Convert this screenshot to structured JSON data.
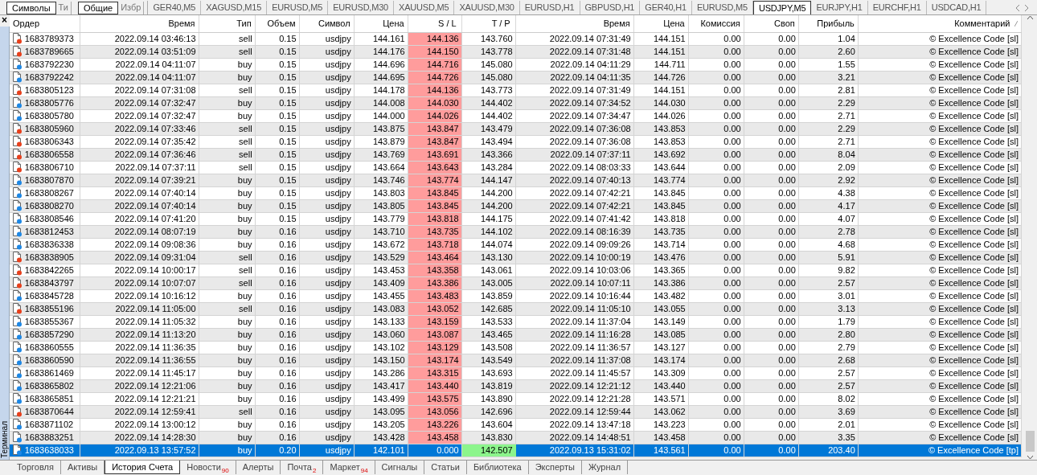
{
  "panel_buttons": [
    {
      "label": "Символы",
      "kind": "button"
    },
    {
      "label": "Ти",
      "kind": "cut"
    },
    {
      "label": "Общие",
      "kind": "button"
    },
    {
      "label": "Избр",
      "kind": "cut"
    }
  ],
  "chart_tabs": [
    {
      "label": "GER40,M5",
      "selected": false
    },
    {
      "label": "XAGUSD,M15",
      "selected": false
    },
    {
      "label": "EURUSD,M5",
      "selected": false
    },
    {
      "label": "EURUSD,M30",
      "selected": false
    },
    {
      "label": "XAUUSD,M5",
      "selected": false
    },
    {
      "label": "XAUUSD,M30",
      "selected": false
    },
    {
      "label": "EURUSD,H1",
      "selected": false
    },
    {
      "label": "GBPUSD,H1",
      "selected": false
    },
    {
      "label": "GER40,H1",
      "selected": false
    },
    {
      "label": "EURUSD,M5",
      "selected": false
    },
    {
      "label": "USDJPY,M5",
      "selected": true
    },
    {
      "label": "EURJPY,H1",
      "selected": false
    },
    {
      "label": "EURCHF,H1",
      "selected": false
    },
    {
      "label": "USDCAD,H1",
      "selected": false
    }
  ],
  "side_panel": {
    "close": "×",
    "title": "Терминал"
  },
  "table": {
    "columns": [
      "Ордер",
      "Время",
      "Тип",
      "Объем",
      "Символ",
      "Цена",
      "S / L",
      "T / P",
      "Время",
      "Цена",
      "Комиссия",
      "Своп",
      "Прибыль",
      "Комментарий"
    ],
    "rows": [
      {
        "kind": "sell",
        "sl_hit": true,
        "tp_hit": false,
        "selected": false,
        "cells": [
          "1683789373",
          "2022.09.14 03:46:13",
          "sell",
          "0.15",
          "usdjpy",
          "144.161",
          "144.136",
          "143.760",
          "2022.09.14 07:31:49",
          "144.151",
          "0.00",
          "0.00",
          "1.04",
          "© Excellence Code [sl]"
        ]
      },
      {
        "kind": "sell",
        "sl_hit": true,
        "tp_hit": false,
        "selected": false,
        "cells": [
          "1683789665",
          "2022.09.14 03:51:09",
          "sell",
          "0.15",
          "usdjpy",
          "144.176",
          "144.150",
          "143.778",
          "2022.09.14 07:31:48",
          "144.151",
          "0.00",
          "0.00",
          "2.60",
          "© Excellence Code [sl]"
        ]
      },
      {
        "kind": "buy",
        "sl_hit": true,
        "tp_hit": false,
        "selected": false,
        "cells": [
          "1683792230",
          "2022.09.14 04:11:07",
          "buy",
          "0.15",
          "usdjpy",
          "144.696",
          "144.716",
          "145.080",
          "2022.09.14 04:11:29",
          "144.711",
          "0.00",
          "0.00",
          "1.55",
          "© Excellence Code [sl]"
        ]
      },
      {
        "kind": "buy",
        "sl_hit": true,
        "tp_hit": false,
        "selected": false,
        "cells": [
          "1683792242",
          "2022.09.14 04:11:07",
          "buy",
          "0.15",
          "usdjpy",
          "144.695",
          "144.726",
          "145.080",
          "2022.09.14 04:11:35",
          "144.726",
          "0.00",
          "0.00",
          "3.21",
          "© Excellence Code [sl]"
        ]
      },
      {
        "kind": "sell",
        "sl_hit": true,
        "tp_hit": false,
        "selected": false,
        "cells": [
          "1683805123",
          "2022.09.14 07:31:08",
          "sell",
          "0.15",
          "usdjpy",
          "144.178",
          "144.136",
          "143.773",
          "2022.09.14 07:31:49",
          "144.151",
          "0.00",
          "0.00",
          "2.81",
          "© Excellence Code [sl]"
        ]
      },
      {
        "kind": "buy",
        "sl_hit": true,
        "tp_hit": false,
        "selected": false,
        "cells": [
          "1683805776",
          "2022.09.14 07:32:47",
          "buy",
          "0.15",
          "usdjpy",
          "144.008",
          "144.030",
          "144.402",
          "2022.09.14 07:34:52",
          "144.030",
          "0.00",
          "0.00",
          "2.29",
          "© Excellence Code [sl]"
        ]
      },
      {
        "kind": "buy",
        "sl_hit": true,
        "tp_hit": false,
        "selected": false,
        "cells": [
          "1683805780",
          "2022.09.14 07:32:47",
          "buy",
          "0.15",
          "usdjpy",
          "144.000",
          "144.026",
          "144.402",
          "2022.09.14 07:34:47",
          "144.026",
          "0.00",
          "0.00",
          "2.71",
          "© Excellence Code [sl]"
        ]
      },
      {
        "kind": "sell",
        "sl_hit": true,
        "tp_hit": false,
        "selected": false,
        "cells": [
          "1683805960",
          "2022.09.14 07:33:46",
          "sell",
          "0.15",
          "usdjpy",
          "143.875",
          "143.847",
          "143.479",
          "2022.09.14 07:36:08",
          "143.853",
          "0.00",
          "0.00",
          "2.29",
          "© Excellence Code [sl]"
        ]
      },
      {
        "kind": "sell",
        "sl_hit": true,
        "tp_hit": false,
        "selected": false,
        "cells": [
          "1683806343",
          "2022.09.14 07:35:42",
          "sell",
          "0.15",
          "usdjpy",
          "143.879",
          "143.847",
          "143.494",
          "2022.09.14 07:36:08",
          "143.853",
          "0.00",
          "0.00",
          "2.71",
          "© Excellence Code [sl]"
        ]
      },
      {
        "kind": "sell",
        "sl_hit": true,
        "tp_hit": false,
        "selected": false,
        "cells": [
          "1683806558",
          "2022.09.14 07:36:46",
          "sell",
          "0.15",
          "usdjpy",
          "143.769",
          "143.691",
          "143.366",
          "2022.09.14 07:37:11",
          "143.692",
          "0.00",
          "0.00",
          "8.04",
          "© Excellence Code [sl]"
        ]
      },
      {
        "kind": "sell",
        "sl_hit": true,
        "tp_hit": false,
        "selected": false,
        "cells": [
          "1683806710",
          "2022.09.14 07:37:11",
          "sell",
          "0.15",
          "usdjpy",
          "143.664",
          "143.643",
          "143.284",
          "2022.09.14 08:03:33",
          "143.644",
          "0.00",
          "0.00",
          "2.09",
          "© Excellence Code [sl]"
        ]
      },
      {
        "kind": "buy",
        "sl_hit": true,
        "tp_hit": false,
        "selected": false,
        "cells": [
          "1683807870",
          "2022.09.14 07:39:21",
          "buy",
          "0.15",
          "usdjpy",
          "143.746",
          "143.774",
          "144.147",
          "2022.09.14 07:40:13",
          "143.774",
          "0.00",
          "0.00",
          "2.92",
          "© Excellence Code [sl]"
        ]
      },
      {
        "kind": "buy",
        "sl_hit": true,
        "tp_hit": false,
        "selected": false,
        "cells": [
          "1683808267",
          "2022.09.14 07:40:14",
          "buy",
          "0.15",
          "usdjpy",
          "143.803",
          "143.845",
          "144.200",
          "2022.09.14 07:42:21",
          "143.845",
          "0.00",
          "0.00",
          "4.38",
          "© Excellence Code [sl]"
        ]
      },
      {
        "kind": "buy",
        "sl_hit": true,
        "tp_hit": false,
        "selected": false,
        "cells": [
          "1683808270",
          "2022.09.14 07:40:14",
          "buy",
          "0.15",
          "usdjpy",
          "143.805",
          "143.845",
          "144.200",
          "2022.09.14 07:42:21",
          "143.845",
          "0.00",
          "0.00",
          "4.17",
          "© Excellence Code [sl]"
        ]
      },
      {
        "kind": "buy",
        "sl_hit": true,
        "tp_hit": false,
        "selected": false,
        "cells": [
          "1683808546",
          "2022.09.14 07:41:20",
          "buy",
          "0.15",
          "usdjpy",
          "143.779",
          "143.818",
          "144.175",
          "2022.09.14 07:41:42",
          "143.818",
          "0.00",
          "0.00",
          "4.07",
          "© Excellence Code [sl]"
        ]
      },
      {
        "kind": "buy",
        "sl_hit": true,
        "tp_hit": false,
        "selected": false,
        "cells": [
          "1683812453",
          "2022.09.14 08:07:19",
          "buy",
          "0.16",
          "usdjpy",
          "143.710",
          "143.735",
          "144.102",
          "2022.09.14 08:16:39",
          "143.735",
          "0.00",
          "0.00",
          "2.78",
          "© Excellence Code [sl]"
        ]
      },
      {
        "kind": "buy",
        "sl_hit": true,
        "tp_hit": false,
        "selected": false,
        "cells": [
          "1683836338",
          "2022.09.14 09:08:36",
          "buy",
          "0.16",
          "usdjpy",
          "143.672",
          "143.718",
          "144.074",
          "2022.09.14 09:09:26",
          "143.714",
          "0.00",
          "0.00",
          "4.68",
          "© Excellence Code [sl]"
        ]
      },
      {
        "kind": "sell",
        "sl_hit": true,
        "tp_hit": false,
        "selected": false,
        "cells": [
          "1683838905",
          "2022.09.14 09:31:04",
          "sell",
          "0.16",
          "usdjpy",
          "143.529",
          "143.464",
          "143.130",
          "2022.09.14 10:00:19",
          "143.476",
          "0.00",
          "0.00",
          "5.91",
          "© Excellence Code [sl]"
        ]
      },
      {
        "kind": "sell",
        "sl_hit": true,
        "tp_hit": false,
        "selected": false,
        "cells": [
          "1683842265",
          "2022.09.14 10:00:17",
          "sell",
          "0.16",
          "usdjpy",
          "143.453",
          "143.358",
          "143.061",
          "2022.09.14 10:03:06",
          "143.365",
          "0.00",
          "0.00",
          "9.82",
          "© Excellence Code [sl]"
        ]
      },
      {
        "kind": "sell",
        "sl_hit": true,
        "tp_hit": false,
        "selected": false,
        "cells": [
          "1683843797",
          "2022.09.14 10:07:07",
          "sell",
          "0.16",
          "usdjpy",
          "143.409",
          "143.386",
          "143.005",
          "2022.09.14 10:07:11",
          "143.386",
          "0.00",
          "0.00",
          "2.57",
          "© Excellence Code [sl]"
        ]
      },
      {
        "kind": "buy",
        "sl_hit": true,
        "tp_hit": false,
        "selected": false,
        "cells": [
          "1683845728",
          "2022.09.14 10:16:12",
          "buy",
          "0.16",
          "usdjpy",
          "143.455",
          "143.483",
          "143.859",
          "2022.09.14 10:16:44",
          "143.482",
          "0.00",
          "0.00",
          "3.01",
          "© Excellence Code [sl]"
        ]
      },
      {
        "kind": "sell",
        "sl_hit": true,
        "tp_hit": false,
        "selected": false,
        "cells": [
          "1683855196",
          "2022.09.14 11:05:00",
          "sell",
          "0.16",
          "usdjpy",
          "143.083",
          "143.052",
          "142.685",
          "2022.09.14 11:05:10",
          "143.055",
          "0.00",
          "0.00",
          "3.13",
          "© Excellence Code [sl]"
        ]
      },
      {
        "kind": "buy",
        "sl_hit": true,
        "tp_hit": false,
        "selected": false,
        "cells": [
          "1683855367",
          "2022.09.14 11:05:32",
          "buy",
          "0.16",
          "usdjpy",
          "143.133",
          "143.159",
          "143.533",
          "2022.09.14 11:37:04",
          "143.149",
          "0.00",
          "0.00",
          "1.79",
          "© Excellence Code [sl]"
        ]
      },
      {
        "kind": "buy",
        "sl_hit": true,
        "tp_hit": false,
        "selected": false,
        "cells": [
          "1683857290",
          "2022.09.14 11:13:20",
          "buy",
          "0.16",
          "usdjpy",
          "143.060",
          "143.087",
          "143.465",
          "2022.09.14 11:16:28",
          "143.085",
          "0.00",
          "0.00",
          "2.80",
          "© Excellence Code [sl]"
        ]
      },
      {
        "kind": "buy",
        "sl_hit": true,
        "tp_hit": false,
        "selected": false,
        "cells": [
          "1683860555",
          "2022.09.14 11:36:35",
          "buy",
          "0.16",
          "usdjpy",
          "143.102",
          "143.129",
          "143.508",
          "2022.09.14 11:36:57",
          "143.127",
          "0.00",
          "0.00",
          "2.79",
          "© Excellence Code [sl]"
        ]
      },
      {
        "kind": "buy",
        "sl_hit": true,
        "tp_hit": false,
        "selected": false,
        "cells": [
          "1683860590",
          "2022.09.14 11:36:55",
          "buy",
          "0.16",
          "usdjpy",
          "143.150",
          "143.174",
          "143.549",
          "2022.09.14 11:37:08",
          "143.174",
          "0.00",
          "0.00",
          "2.68",
          "© Excellence Code [sl]"
        ]
      },
      {
        "kind": "buy",
        "sl_hit": true,
        "tp_hit": false,
        "selected": false,
        "cells": [
          "1683861469",
          "2022.09.14 11:45:17",
          "buy",
          "0.16",
          "usdjpy",
          "143.286",
          "143.315",
          "143.693",
          "2022.09.14 11:45:57",
          "143.309",
          "0.00",
          "0.00",
          "2.57",
          "© Excellence Code [sl]"
        ]
      },
      {
        "kind": "buy",
        "sl_hit": true,
        "tp_hit": false,
        "selected": false,
        "cells": [
          "1683865802",
          "2022.09.14 12:21:06",
          "buy",
          "0.16",
          "usdjpy",
          "143.417",
          "143.440",
          "143.819",
          "2022.09.14 12:21:12",
          "143.440",
          "0.00",
          "0.00",
          "2.57",
          "© Excellence Code [sl]"
        ]
      },
      {
        "kind": "buy",
        "sl_hit": true,
        "tp_hit": false,
        "selected": false,
        "cells": [
          "1683865851",
          "2022.09.14 12:21:21",
          "buy",
          "0.16",
          "usdjpy",
          "143.499",
          "143.575",
          "143.890",
          "2022.09.14 12:21:28",
          "143.571",
          "0.00",
          "0.00",
          "8.02",
          "© Excellence Code [sl]"
        ]
      },
      {
        "kind": "sell",
        "sl_hit": true,
        "tp_hit": false,
        "selected": false,
        "cells": [
          "1683870644",
          "2022.09.14 12:59:41",
          "sell",
          "0.16",
          "usdjpy",
          "143.095",
          "143.056",
          "142.696",
          "2022.09.14 12:59:44",
          "143.062",
          "0.00",
          "0.00",
          "3.69",
          "© Excellence Code [sl]"
        ]
      },
      {
        "kind": "buy",
        "sl_hit": true,
        "tp_hit": false,
        "selected": false,
        "cells": [
          "1683871102",
          "2022.09.14 13:00:12",
          "buy",
          "0.16",
          "usdjpy",
          "143.205",
          "143.226",
          "143.604",
          "2022.09.14 13:47:18",
          "143.223",
          "0.00",
          "0.00",
          "2.01",
          "© Excellence Code [sl]"
        ]
      },
      {
        "kind": "buy",
        "sl_hit": true,
        "tp_hit": false,
        "selected": false,
        "cells": [
          "1683883251",
          "2022.09.14 14:28:30",
          "buy",
          "0.16",
          "usdjpy",
          "143.428",
          "143.458",
          "143.830",
          "2022.09.14 14:48:51",
          "143.458",
          "0.00",
          "0.00",
          "3.35",
          "© Excellence Code [sl]"
        ]
      },
      {
        "kind": "buy",
        "sl_hit": false,
        "tp_hit": true,
        "selected": true,
        "cells": [
          "1683638033",
          "2022.09.13 13:57:52",
          "buy",
          "0.20",
          "usdjpy",
          "142.101",
          "0.000",
          "142.507",
          "2022.09.13 15:31:02",
          "143.561",
          "0.00",
          "0.00",
          "203.40",
          "© Excellence Code [tp]"
        ]
      }
    ]
  },
  "bottom_tabs": [
    {
      "label": "Торговля",
      "selected": false
    },
    {
      "label": "Активы",
      "selected": false
    },
    {
      "label": "История Счета",
      "selected": true
    },
    {
      "label": "Новости",
      "count": "90",
      "selected": false
    },
    {
      "label": "Алерты",
      "selected": false
    },
    {
      "label": "Почта",
      "count": "2",
      "selected": false
    },
    {
      "label": "Маркет",
      "count": "94",
      "selected": false
    },
    {
      "label": "Сигналы",
      "selected": false
    },
    {
      "label": "Статьи",
      "selected": false
    },
    {
      "label": "Библиотека",
      "selected": false
    },
    {
      "label": "Эксперты",
      "selected": false
    },
    {
      "label": "Журнал",
      "selected": false
    }
  ]
}
